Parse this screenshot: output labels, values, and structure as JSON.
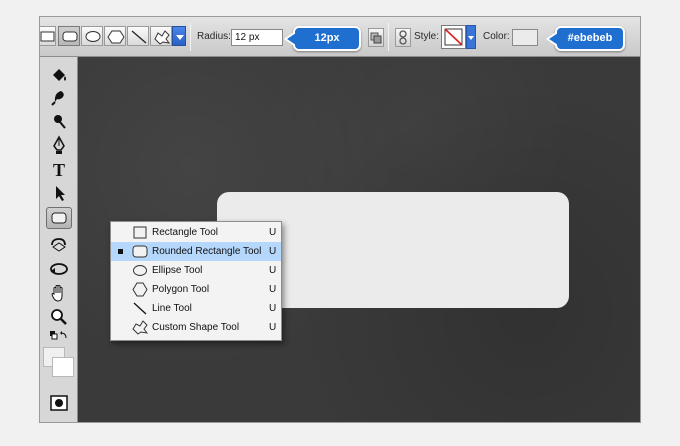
{
  "options_bar": {
    "shape_buttons": [
      {
        "icon": "rectangle-icon"
      },
      {
        "icon": "rounded-rectangle-icon",
        "active": true
      },
      {
        "icon": "ellipse-icon"
      },
      {
        "icon": "polygon-icon"
      },
      {
        "icon": "line-icon"
      },
      {
        "icon": "custom-shape-icon"
      }
    ],
    "radius_label": "Radius:",
    "radius_value": "12 px",
    "radius_callout": "12px",
    "style_label": "Style:",
    "color_label": "Color:",
    "color_value": "#ebebeb",
    "color_callout": "#ebebeb"
  },
  "flyout": {
    "items": [
      {
        "label": "Rectangle Tool",
        "shortcut": "U",
        "icon": "rectangle-tool-icon",
        "selected": false
      },
      {
        "label": "Rounded Rectangle Tool",
        "shortcut": "U",
        "icon": "rounded-rectangle-tool-icon",
        "selected": true
      },
      {
        "label": "Ellipse Tool",
        "shortcut": "U",
        "icon": "ellipse-tool-icon",
        "selected": false
      },
      {
        "label": "Polygon Tool",
        "shortcut": "U",
        "icon": "polygon-tool-icon",
        "selected": false
      },
      {
        "label": "Line Tool",
        "shortcut": "U",
        "icon": "line-tool-icon",
        "selected": false
      },
      {
        "label": "Custom Shape Tool",
        "shortcut": "U",
        "icon": "custom-shape-tool-icon",
        "selected": false
      }
    ]
  },
  "colors": {
    "accent": "#1f6fd1",
    "shape_fill": "#ebebeb",
    "canvas": "#3a3a3a",
    "selection": "#b5d7fb"
  }
}
